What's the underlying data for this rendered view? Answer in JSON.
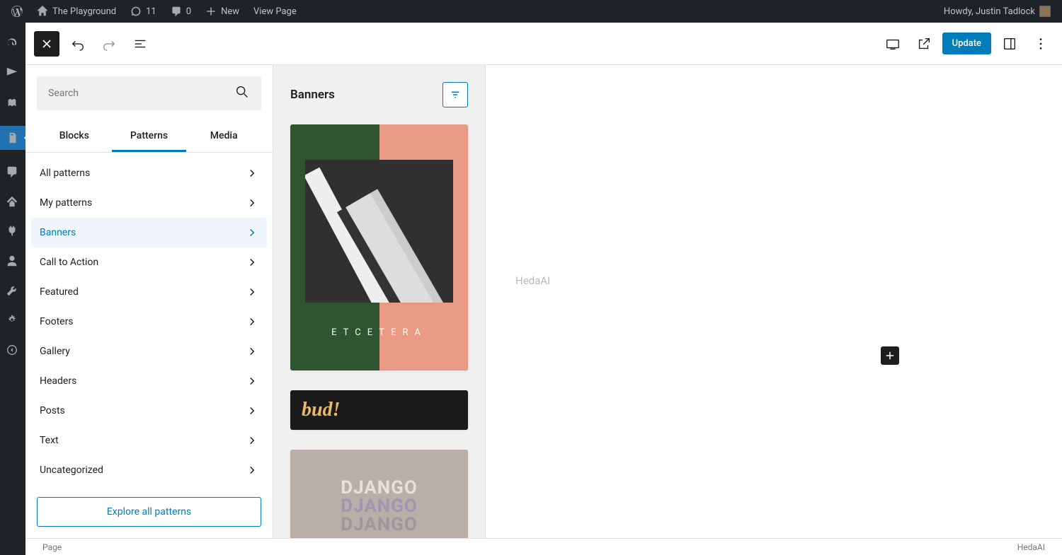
{
  "adminbar": {
    "site_title": "The Playground",
    "updates_count": "11",
    "comments_count": "0",
    "new_label": "New",
    "view_page": "View Page",
    "howdy": "Howdy, Justin Tadlock"
  },
  "toolbar": {
    "update_label": "Update"
  },
  "inserter": {
    "search_placeholder": "Search",
    "tabs": {
      "blocks": "Blocks",
      "patterns": "Patterns",
      "media": "Media"
    },
    "categories": [
      {
        "label": "All patterns"
      },
      {
        "label": "My patterns"
      },
      {
        "label": "Banners"
      },
      {
        "label": "Call to Action"
      },
      {
        "label": "Featured"
      },
      {
        "label": "Footers"
      },
      {
        "label": "Gallery"
      },
      {
        "label": "Headers"
      },
      {
        "label": "Posts"
      },
      {
        "label": "Text"
      },
      {
        "label": "Uncategorized"
      }
    ],
    "explore_label": "Explore all patterns"
  },
  "preview": {
    "title": "Banners",
    "pattern1_caption": "ETCETERA",
    "pattern2_caption": "bud!",
    "pattern3_caption": "DJANGO"
  },
  "canvas": {
    "placeholder": "HedaAI"
  },
  "status": {
    "breadcrumb": "Page",
    "watermark": "HedaAI"
  }
}
